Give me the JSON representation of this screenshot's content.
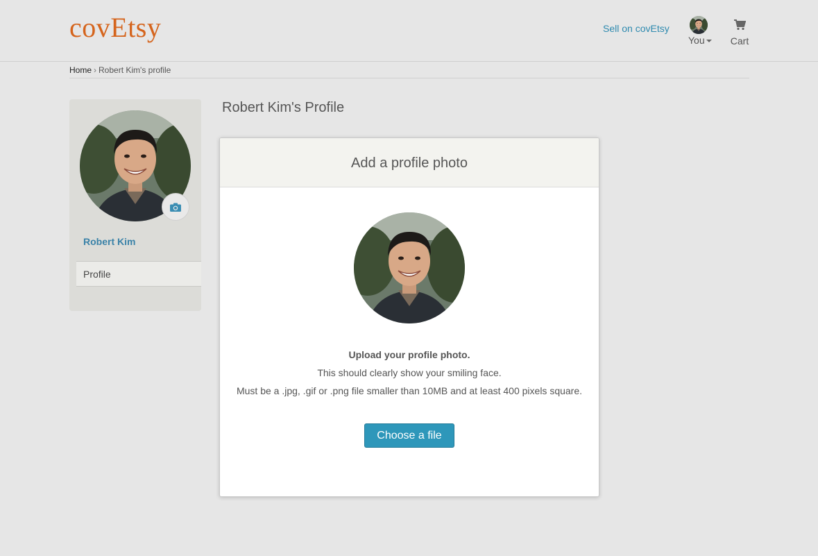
{
  "header": {
    "logo": "covEtsy",
    "sell_link": "Sell on covEtsy",
    "you_label": "You",
    "cart_label": "Cart"
  },
  "breadcrumb": {
    "home": "Home",
    "separator": "›",
    "current": "Robert Kim's profile"
  },
  "sidebar": {
    "name": "Robert Kim",
    "nav_item": "Profile"
  },
  "page_title": "Robert Kim's Profile",
  "modal": {
    "title": "Add a profile photo",
    "heading": "Upload your profile photo.",
    "line1": "This should clearly show your smiling face.",
    "line2": "Must be a .jpg, .gif or .png file smaller than 10MB and at least 400 pixels square.",
    "button": "Choose a file"
  },
  "colors": {
    "logo": "#d5641c",
    "link": "#2e8aaf",
    "button": "#2e97ba",
    "background": "#e6e6e6"
  }
}
